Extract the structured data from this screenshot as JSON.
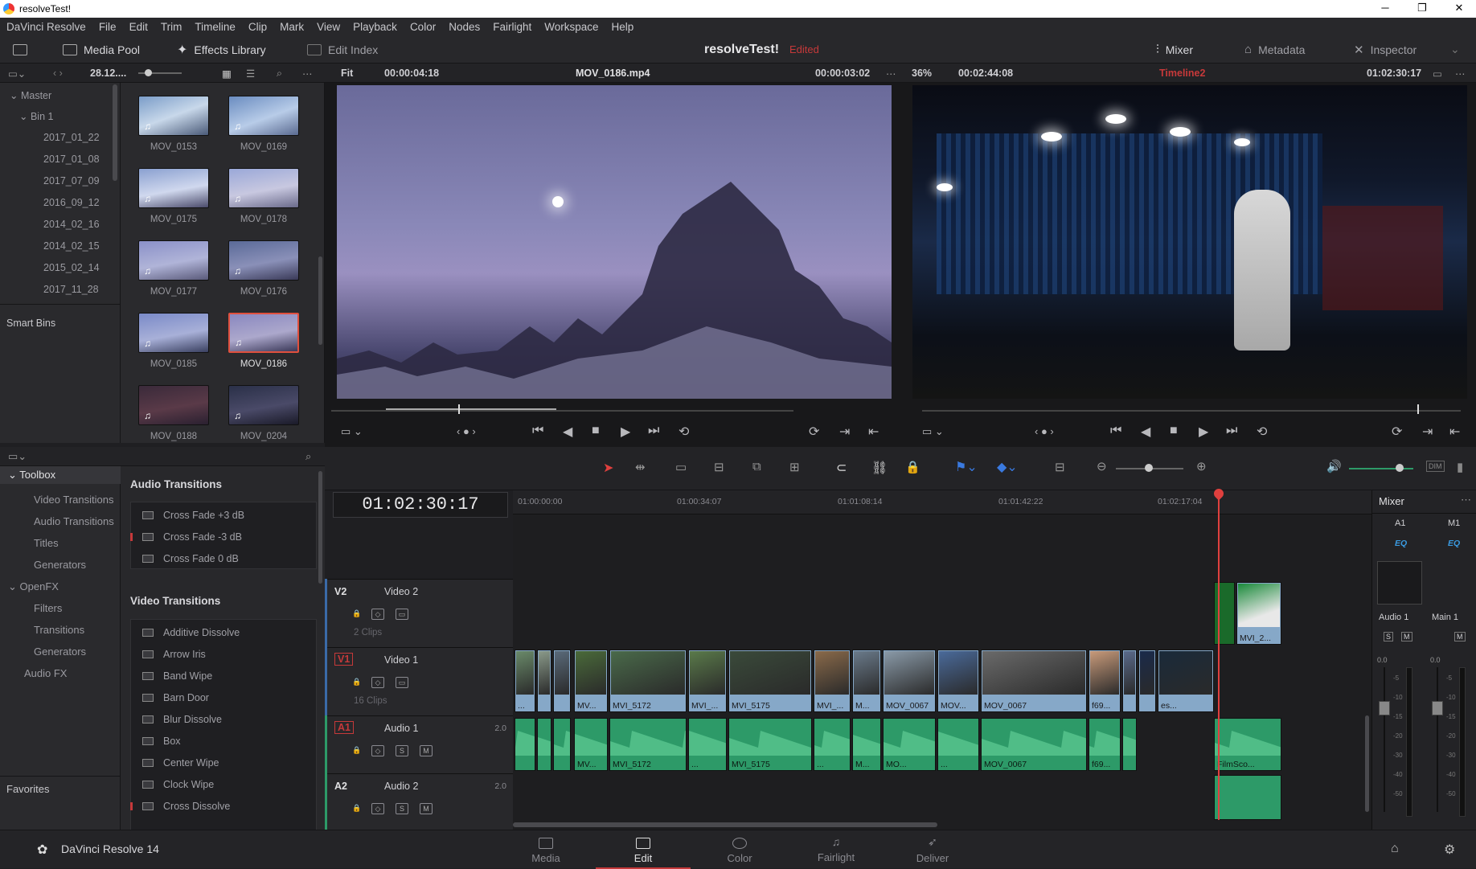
{
  "window": {
    "title": "resolveTest!",
    "minimize": "─",
    "maximize": "❐",
    "close": "✕"
  },
  "menu": [
    "DaVinci Resolve",
    "File",
    "Edit",
    "Trim",
    "Timeline",
    "Clip",
    "Mark",
    "View",
    "Playback",
    "Color",
    "Nodes",
    "Fairlight",
    "Workspace",
    "Help"
  ],
  "toolbar": {
    "media_pool": "Media Pool",
    "effects_library": "Effects Library",
    "edit_index": "Edit Index",
    "project_title": "resolveTest!",
    "status": "Edited",
    "mixer": "Mixer",
    "metadata": "Metadata",
    "inspector": "Inspector"
  },
  "viewer_header": {
    "bin_date": "28.12....",
    "src_zoom": "Fit",
    "src_duration": "00:00:04:18",
    "src_clip": "MOV_0186.mp4",
    "src_timecode": "00:00:03:02",
    "rec_zoom": "36%",
    "rec_duration": "00:02:44:08",
    "timeline_name": "Timeline2",
    "rec_timecode": "01:02:30:17"
  },
  "bins": {
    "master": "Master",
    "bin1": "Bin 1",
    "dates": [
      "2017_01_22",
      "2017_01_08",
      "2017_07_09",
      "2016_09_12",
      "2014_02_16",
      "2014_02_15",
      "2015_02_14",
      "2017_11_28"
    ],
    "smart_bins": "Smart Bins",
    "favorites": "Favorites"
  },
  "clips": [
    "MOV_0153",
    "MOV_0169",
    "MOV_0175",
    "MOV_0178",
    "MOV_0177",
    "MOV_0176",
    "MOV_0185",
    "MOV_0186",
    "MOV_0188",
    "MOV_0204"
  ],
  "toolbox": {
    "toolbox": "Toolbox",
    "video_transitions": "Video Transitions",
    "audio_transitions": "Audio Transitions",
    "titles": "Titles",
    "generators": "Generators",
    "openfx": "OpenFX",
    "filters": "Filters",
    "transitions": "Transitions",
    "generators2": "Generators",
    "audio_fx": "Audio FX"
  },
  "audio_transitions": {
    "heading": "Audio Transitions",
    "items": [
      "Cross Fade +3 dB",
      "Cross Fade -3 dB",
      "Cross Fade 0 dB"
    ]
  },
  "video_transitions": {
    "heading": "Video Transitions",
    "items": [
      "Additive Dissolve",
      "Arrow Iris",
      "Band Wipe",
      "Barn Door",
      "Blur Dissolve",
      "Box",
      "Center Wipe",
      "Clock Wipe",
      "Cross Dissolve"
    ]
  },
  "timeline": {
    "timecode": "01:02:30:17",
    "ruler": [
      "01:00:00:00",
      "01:00:34:07",
      "01:01:08:14",
      "01:01:42:22",
      "01:02:17:04"
    ],
    "tracks": {
      "v2": {
        "id": "V2",
        "name": "Video 2",
        "count": "2 Clips"
      },
      "v1": {
        "id": "V1",
        "name": "Video 1",
        "count": "16 Clips"
      },
      "a1": {
        "id": "A1",
        "name": "Audio 1",
        "vol": "2.0"
      },
      "a2": {
        "id": "A2",
        "name": "Audio 2",
        "vol": "2.0"
      }
    },
    "v1_labels": [
      "...",
      "",
      "",
      "MV...",
      "MVI_5172",
      "MVI_...",
      "MVI_5175",
      "MVI_...",
      "M...",
      "MOV_0067",
      "MOV...",
      "MOV_0067",
      "f69...",
      "",
      "",
      "es..."
    ],
    "v2_labels": [
      "",
      "MVI_2..."
    ],
    "a1_labels": [
      "",
      "",
      "",
      "MV...",
      "MVI_5172",
      "...",
      "MVI_5175",
      "...",
      "M...",
      "MO...",
      "...",
      "MOV_0067",
      "f69...",
      "",
      "FilmSco..."
    ],
    "solo": "S",
    "mute": "M"
  },
  "mixer": {
    "title": "Mixer",
    "ch1": "A1",
    "ch2": "M1",
    "eq": "EQ",
    "strip1": "Audio 1",
    "strip2": "Main 1",
    "level": "0.0",
    "scale": [
      "-5",
      "-10",
      "-15",
      "-20",
      "-30",
      "-40",
      "-50"
    ]
  },
  "pages": [
    "Media",
    "Edit",
    "Color",
    "Fairlight",
    "Deliver"
  ],
  "app_name": "DaVinci Resolve 14",
  "colors": {
    "accent": "#c6393a",
    "video_clip": "#86a8c8",
    "audio_clip": "#2d9a68",
    "playhead": "#e0403e"
  }
}
